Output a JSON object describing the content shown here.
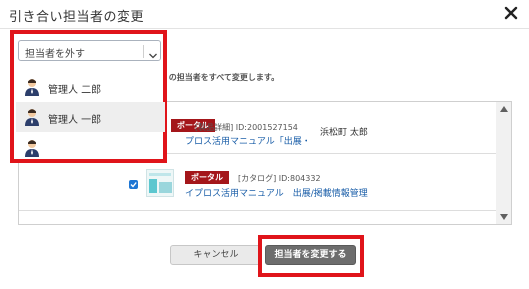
{
  "dialog": {
    "title": "引き合い担当者の変更",
    "description": "い の担当者をすべて変更します。"
  },
  "dropdown": {
    "selected": "担当者を外す",
    "options": [
      {
        "label": "管理人 二郎"
      },
      {
        "label": "管理人 一郎"
      },
      {
        "label": ""
      }
    ]
  },
  "items": [
    {
      "tag": "ポータル",
      "meta": "[製品詳細] ID:2001527154",
      "link": "プロス活用マニュアル「出展・掲…",
      "person": "浜松町 太郎"
    },
    {
      "tag": "ポータル",
      "meta": "[カタログ] ID:804332",
      "link": "イプロス活用マニュアル　出展/掲載情報管理",
      "person": ""
    }
  ],
  "buttons": {
    "cancel": "キャンセル",
    "change": "担当者を変更する"
  },
  "colors": {
    "highlight": "#e0141a",
    "tag": "#a4161a",
    "link": "#1a5ea8",
    "checkbox": "#1e76d4",
    "primary_button": "#6d6d6d"
  }
}
